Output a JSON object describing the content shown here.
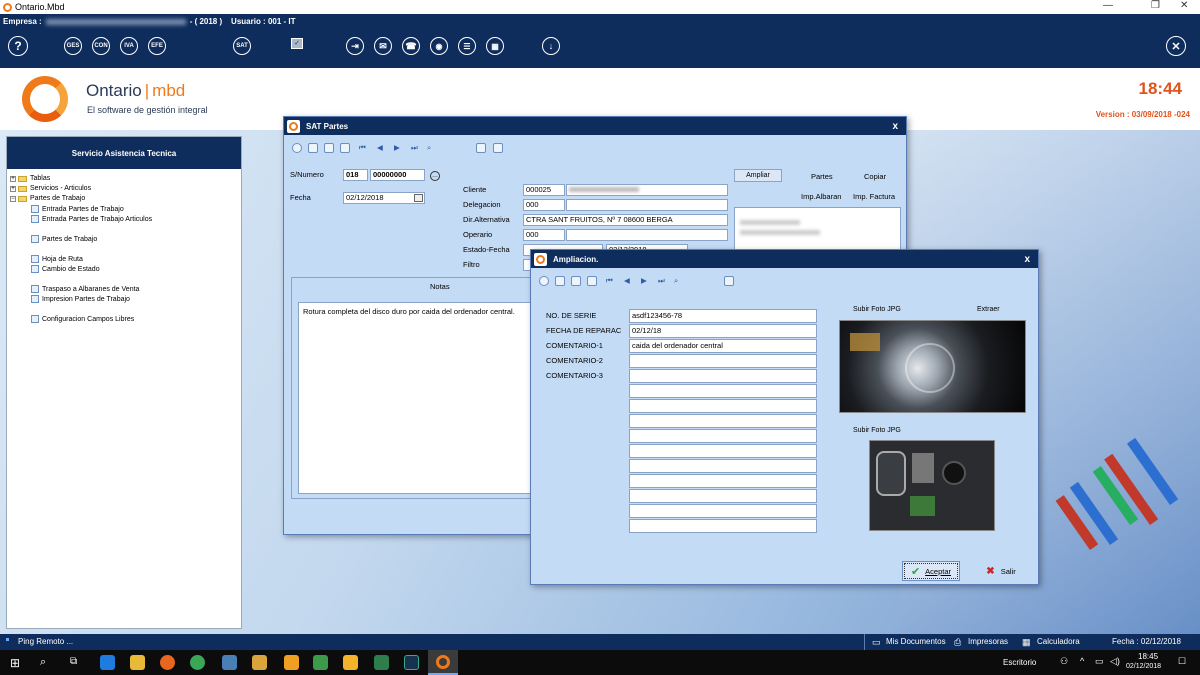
{
  "window": {
    "title": "Ontario.Mbd"
  },
  "toolbar": {
    "company_label": "Empresa :",
    "year": "- ( 2018 )",
    "user": "Usuario : 001 - IT",
    "buttons": [
      "?",
      "GES",
      "CON",
      "IVA",
      "EFE",
      "SAT"
    ]
  },
  "header": {
    "brand_main": "Ontario",
    "brand_sep": "|",
    "brand_mbd": "mbd",
    "tagline": "El software de gestión integral",
    "clock": "18:44",
    "version": "Version : 03/09/2018 -024"
  },
  "sidebar": {
    "title": "Servicio Asistencia Tecnica",
    "items": [
      {
        "label": "Tablas",
        "type": "folder"
      },
      {
        "label": "Servicios - Articulos",
        "type": "folder"
      },
      {
        "label": "Partes de Trabajo",
        "type": "folder"
      },
      {
        "label": "Entrada Partes de Trabajo",
        "type": "doc"
      },
      {
        "label": "Entrada Partes de Trabajo Articulos",
        "type": "doc"
      },
      {
        "label": "Partes de Trabajo",
        "type": "doc"
      },
      {
        "label": "Hoja de Ruta",
        "type": "doc"
      },
      {
        "label": "Cambio de Estado",
        "type": "doc"
      },
      {
        "label": "Traspaso a Albaranes de Venta",
        "type": "doc"
      },
      {
        "label": "Impresion Partes de Trabajo",
        "type": "doc"
      },
      {
        "label": "Configuracion Campos Libres",
        "type": "doc"
      }
    ]
  },
  "sat": {
    "title": "SAT Partes",
    "close": "x",
    "snumero_label": "S/Numero",
    "snumero_serie": "018",
    "snumero_num": "00000000",
    "fecha_label": "Fecha",
    "fecha": "02/12/2018",
    "cliente_label": "Cliente",
    "cliente": "000025",
    "delegacion_label": "Delegacion",
    "delegacion": "000",
    "diralt_label": "Dir.Alternativa",
    "diralt": "CTRA SANT FRUITOS, Nº 7 08600 BERGA",
    "operario_label": "Operario",
    "operario": "000",
    "estado_label": "Estado-Fecha",
    "estado_fecha": "02/12/2018",
    "filtro_label": "Filtro",
    "ampliar": "Ampliar",
    "partes": "Partes",
    "copiar": "Copiar",
    "imp_albaran": "Imp.Albaran",
    "imp_factura": "Imp. Factura",
    "notas_label": "Notas",
    "notas": "Rotura completa del disco duro por caida del ordenador central."
  },
  "amp": {
    "title": "Ampliacion.",
    "close": "x",
    "fields": [
      {
        "label": "NO. DE SERIE",
        "value": "asdf123456-78"
      },
      {
        "label": "FECHA DE REPARAC",
        "value": "02/12/18"
      },
      {
        "label": "COMENTARIO-1",
        "value": "caida del ordenador central"
      },
      {
        "label": "COMENTARIO-2",
        "value": ""
      },
      {
        "label": "COMENTARIO-3",
        "value": ""
      }
    ],
    "subir1": "Subir Foto JPG",
    "extraer1": "Extraer",
    "subir2": "Subir Foto JPG",
    "aceptar": "Aceptar",
    "salir": "Salir"
  },
  "status": {
    "ping": "Ping Remoto ...",
    "docs": "Mis Documentos",
    "impresoras": "Impresoras",
    "calculadora": "Calculadora",
    "fecha": "Fecha : 02/12/2018"
  },
  "taskbar": {
    "escritorio": "Escritorio",
    "time": "18:45",
    "date": "02/12/2018"
  }
}
